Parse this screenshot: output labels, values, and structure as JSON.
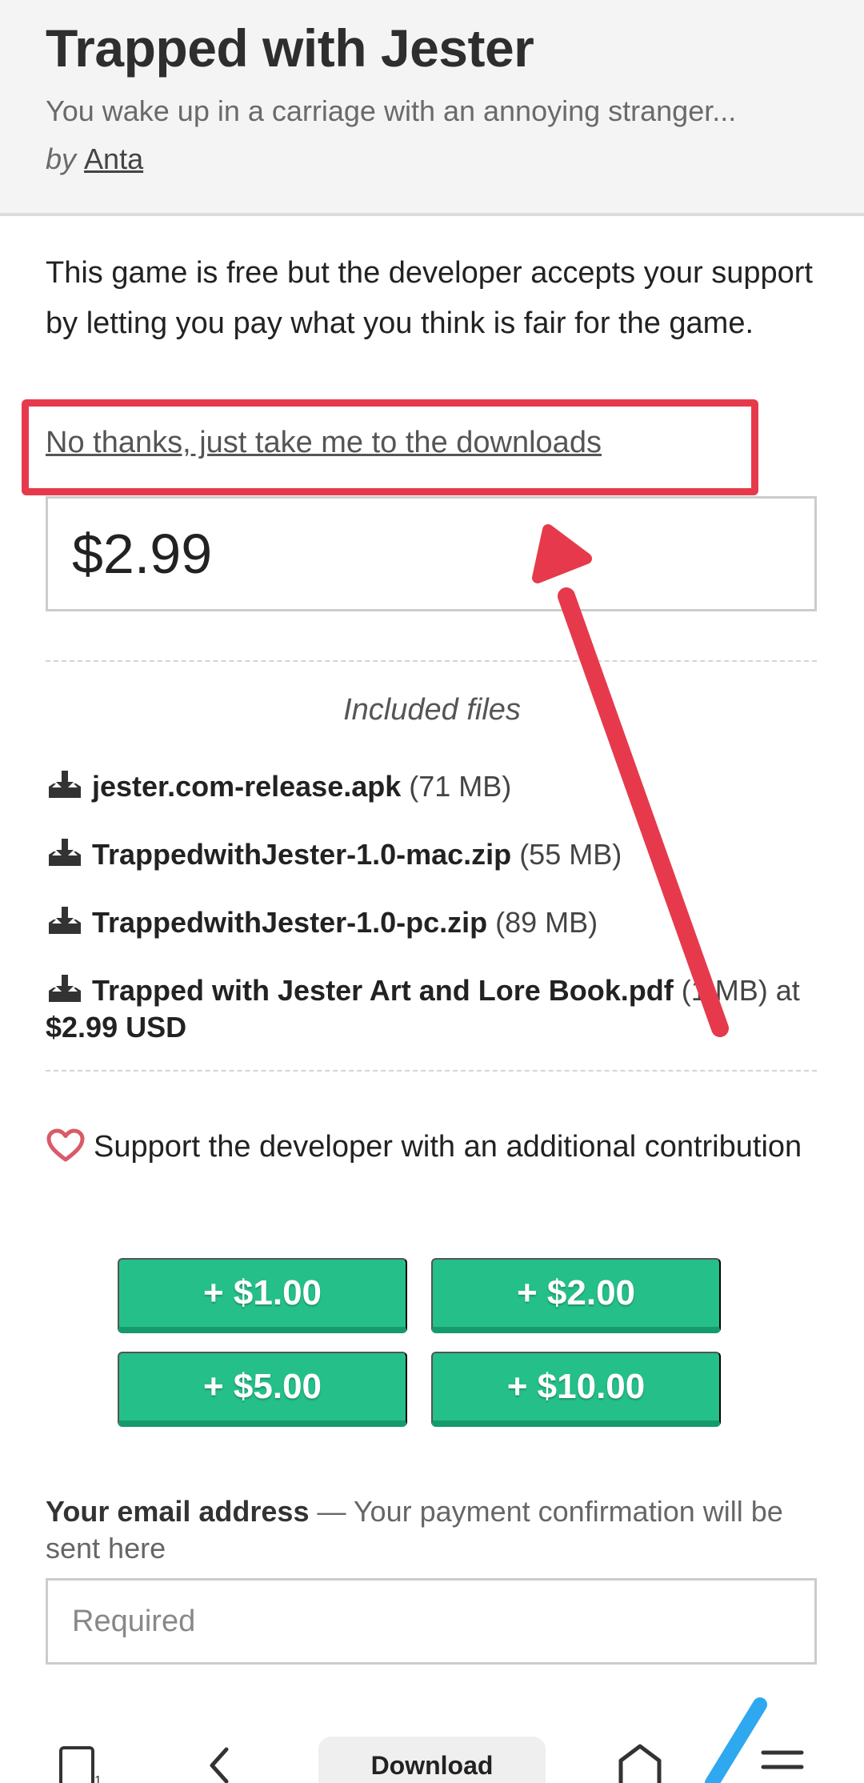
{
  "header": {
    "title": "Trapped with Jester",
    "tagline": "You wake up in a carriage with an annoying stranger...",
    "by_prefix": "by",
    "author": "Anta"
  },
  "purchase": {
    "intro": "This game is free but the developer accepts your support by letting you pay what you think is fair for the game.",
    "skip_link": "No thanks, just take me to the downloads",
    "price_value": "$2.99"
  },
  "files": {
    "heading": "Included files",
    "items": [
      {
        "name": "jester.com-release.apk",
        "size": "(71 MB)",
        "suffix": ""
      },
      {
        "name": "TrappedwithJester-1.0-mac.zip",
        "size": "(55 MB)",
        "suffix": ""
      },
      {
        "name": "TrappedwithJester-1.0-pc.zip",
        "size": "(89 MB)",
        "suffix": ""
      },
      {
        "name": "Trapped with Jester Art and Lore Book.pdf",
        "size": "(1 MB)",
        "suffix": "at",
        "price": "$2.99 USD"
      }
    ]
  },
  "support": {
    "text": "Support the developer with an additional contribution",
    "tips": [
      "+ $1.00",
      "+ $2.00",
      "+ $5.00",
      "+ $10.00"
    ]
  },
  "email": {
    "label": "Your email address",
    "note": "— Your payment confirmation will be sent here",
    "placeholder": "Required"
  },
  "bottom_nav": {
    "tab_count": "1",
    "download_label": "Download"
  },
  "colors": {
    "accent_green": "#25c08a",
    "annotation_red": "#e63a4c",
    "heart_red": "#da5a67"
  }
}
